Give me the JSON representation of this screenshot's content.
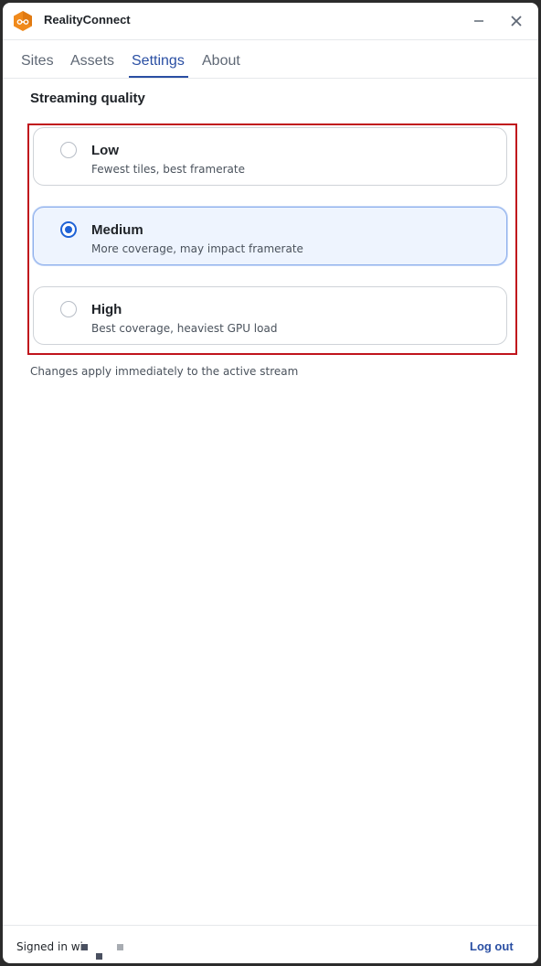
{
  "app": {
    "title": "RealityConnect",
    "logo_icon": "hexagon-link-logo",
    "brand_color": "#f08a1c"
  },
  "window_controls": {
    "minimize_icon": "minimize-icon",
    "close_icon": "close-icon"
  },
  "tabs": [
    {
      "label": "Sites",
      "active": false
    },
    {
      "label": "Assets",
      "active": false
    },
    {
      "label": "Settings",
      "active": true
    },
    {
      "label": "About",
      "active": false
    }
  ],
  "settings": {
    "section_title": "Streaming quality",
    "options": [
      {
        "label": "Low",
        "description": "Fewest tiles, best framerate",
        "selected": false
      },
      {
        "label": "Medium",
        "description": "More coverage, may impact framerate",
        "selected": true
      },
      {
        "label": "High",
        "description": "Best coverage, heaviest GPU load",
        "selected": false
      }
    ],
    "hint": "Changes apply immediately to the active stream"
  },
  "footer": {
    "signed_in_text": "Signed in wi",
    "logout_label": "Log out"
  },
  "colors": {
    "accent": "#2a4fa3",
    "radio_selected": "#1f62d6",
    "highlight_border": "#c0141c",
    "selected_bg": "#eef4fe"
  }
}
